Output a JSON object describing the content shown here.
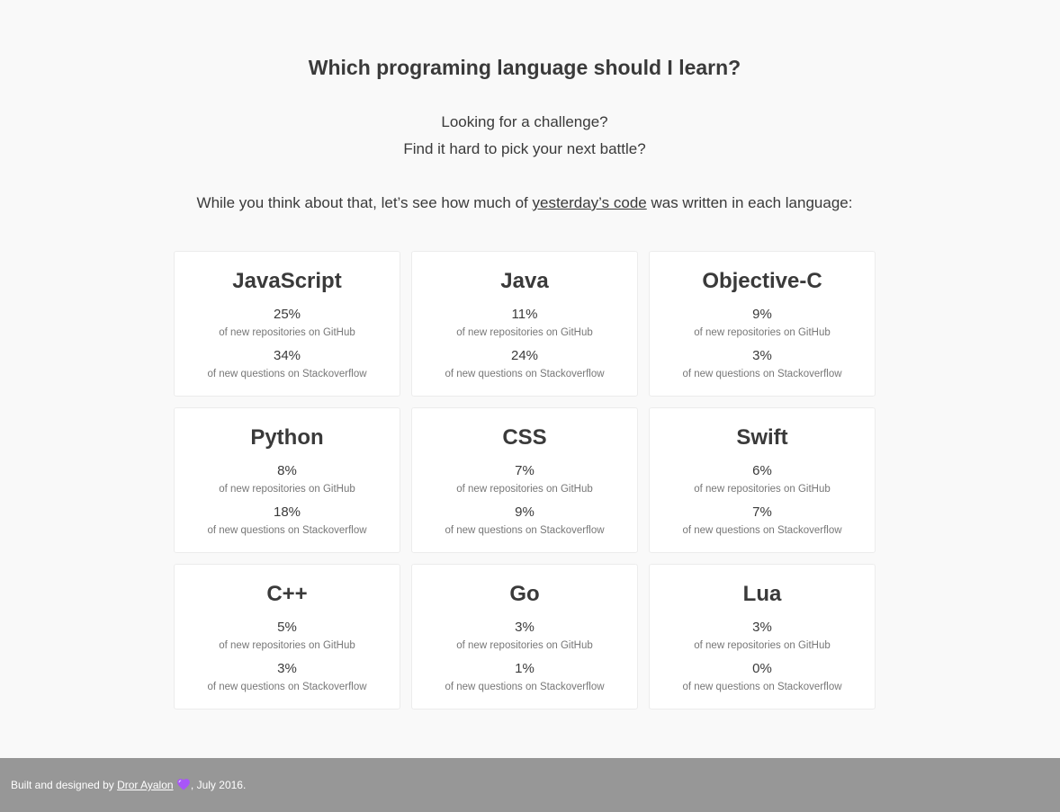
{
  "header": {
    "title": "Which programing language should I learn?",
    "subtitle_line1": "Looking for a challenge?",
    "subtitle_line2": "Find it hard to pick your next battle?",
    "intro_before": "While you think about that, let’s see how much of ",
    "intro_link": "yesterday’s code",
    "intro_after": " was written in each language:"
  },
  "languages": [
    {
      "name": "JavaScript",
      "github_pct": "25%",
      "github_label": "of new repositories on GitHub",
      "so_pct": "34%",
      "so_label": "of new questions on Stackoverflow"
    },
    {
      "name": "Java",
      "github_pct": "11%",
      "github_label": "of new repositories on GitHub",
      "so_pct": "24%",
      "so_label": "of new questions on Stackoverflow"
    },
    {
      "name": "Objective-C",
      "github_pct": "9%",
      "github_label": "of new repositories on GitHub",
      "so_pct": "3%",
      "so_label": "of new questions on Stackoverflow"
    },
    {
      "name": "Python",
      "github_pct": "8%",
      "github_label": "of new repositories on GitHub",
      "so_pct": "18%",
      "so_label": "of new questions on Stackoverflow"
    },
    {
      "name": "CSS",
      "github_pct": "7%",
      "github_label": "of new repositories on GitHub",
      "so_pct": "9%",
      "so_label": "of new questions on Stackoverflow"
    },
    {
      "name": "Swift",
      "github_pct": "6%",
      "github_label": "of new repositories on GitHub",
      "so_pct": "7%",
      "so_label": "of new questions on Stackoverflow"
    },
    {
      "name": "C++",
      "github_pct": "5%",
      "github_label": "of new repositories on GitHub",
      "so_pct": "3%",
      "so_label": "of new questions on Stackoverflow"
    },
    {
      "name": "Go",
      "github_pct": "3%",
      "github_label": "of new repositories on GitHub",
      "so_pct": "1%",
      "so_label": "of new questions on Stackoverflow"
    },
    {
      "name": "Lua",
      "github_pct": "3%",
      "github_label": "of new repositories on GitHub",
      "so_pct": "0%",
      "so_label": "of new questions on Stackoverflow"
    }
  ],
  "footer": {
    "text_before": "Built and designed by ",
    "author_link": "Dror Ayalon",
    "heart_icon": "purple-heart-icon",
    "text_after": ", July 2016."
  },
  "colors": {
    "background": "#f9f9f9",
    "card_background": "#ffffff",
    "footer_background": "#979797",
    "heart": "#a855f7"
  }
}
